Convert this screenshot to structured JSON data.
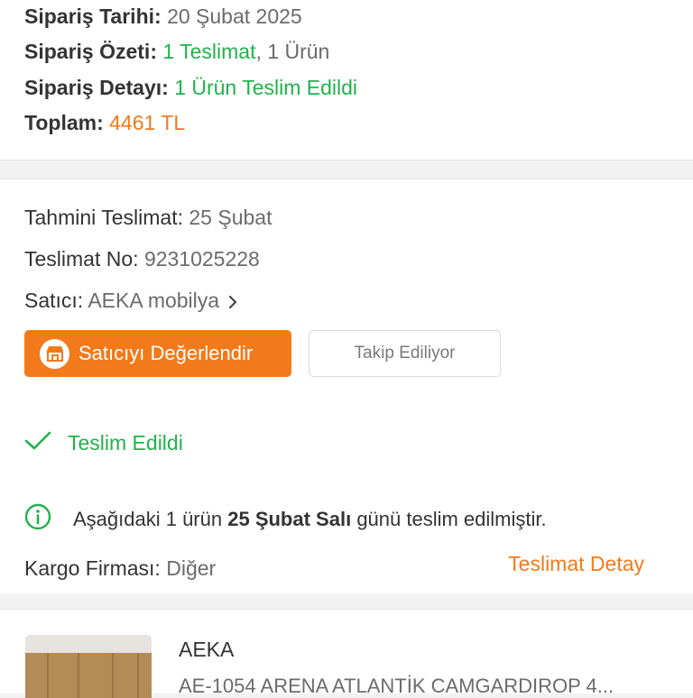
{
  "summary": {
    "date_label": "Sipariş Tarihi:",
    "date_value": "20 Şubat 2025",
    "overview_label": "Sipariş Özeti:",
    "overview_delivery": "1 Teslimat",
    "overview_sep": ",",
    "overview_items": "1 Ürün",
    "detail_label": "Sipariş Detayı:",
    "detail_value": "1 Ürün Teslim Edildi",
    "total_label": "Toplam:",
    "total_value": "4461 TL"
  },
  "shipment": {
    "estimate_label": "Tahmini Teslimat:",
    "estimate_value": "25 Şubat",
    "number_label": "Teslimat No:",
    "number_value": "9231025228",
    "seller_label": "Satıcı:",
    "seller_value": "AEKA mobilya",
    "rate_button": "Satıcıyı Değerlendir",
    "follow_button": "Takip Ediliyor"
  },
  "status": {
    "state": "Teslim Edildi",
    "info_prefix": "Aşağıdaki 1 ürün",
    "info_bold": "25 Şubat Salı",
    "info_suffix": "günü teslim edilmiştir.",
    "cargo_label": "Kargo Firması:",
    "cargo_value": "Diğer",
    "detail_link": "Teslimat Detay"
  },
  "product": {
    "brand": "AEKA",
    "name": "AE-1054 ARENA ATLANTİK CAMGARDIROP 4..."
  },
  "icons": {
    "rate": "store-icon",
    "seller_link": "chevron-right-icon",
    "state": "checkmark-icon",
    "info": "info-circle-icon"
  },
  "colors": {
    "accent_orange": "#f27a1a",
    "success_green": "#22b24c"
  }
}
